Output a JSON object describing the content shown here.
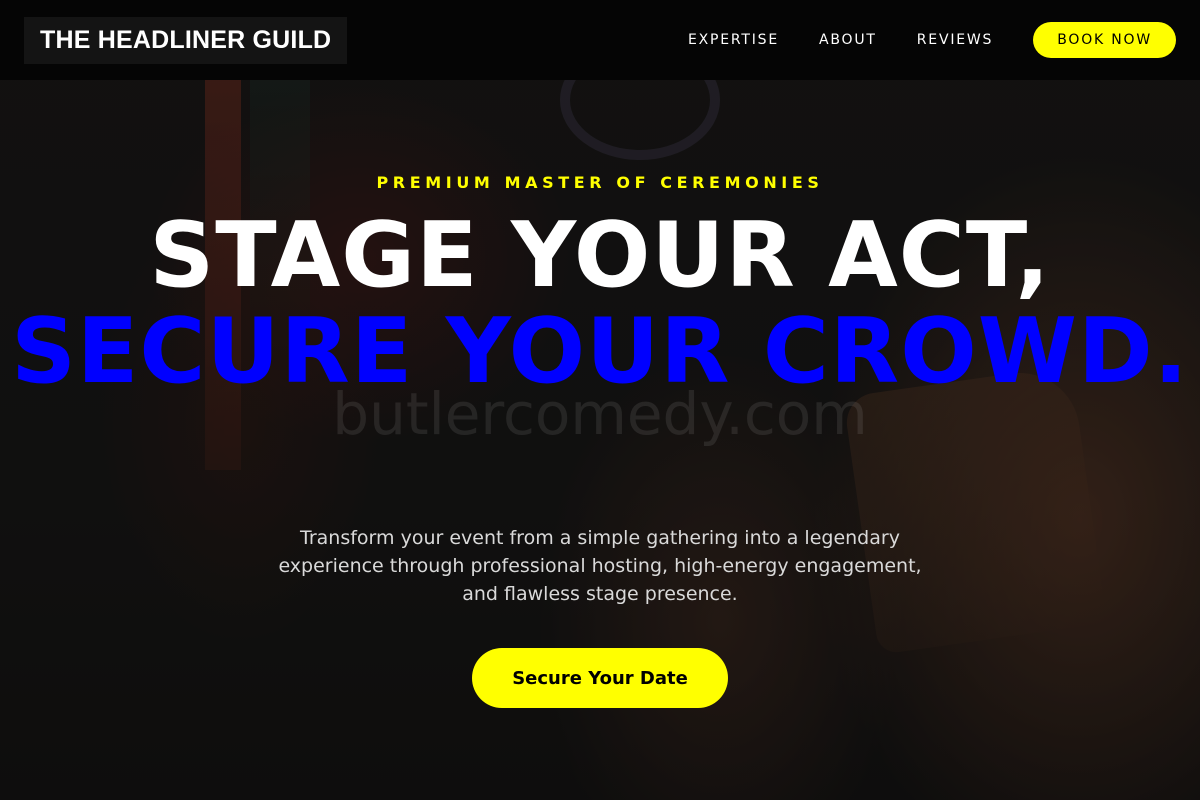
{
  "header": {
    "logo": "THE HEADLINER GUILD",
    "nav": [
      "EXPERTISE",
      "ABOUT",
      "REVIEWS"
    ],
    "book_label": "BOOK NOW"
  },
  "hero": {
    "eyebrow": "PREMIUM MASTER OF CEREMONIES",
    "headline_line1": "STAGE YOUR ACT,",
    "headline_line2": "SECURE YOUR CROWD.",
    "watermark": "butlercomedy.com",
    "subtitle": "Transform your event from a simple gathering into a legendary experience through professional hosting, high-energy engagement, and flawless stage presence.",
    "cta_label": "Secure Your Date"
  },
  "colors": {
    "accent_yellow": "#ffff00",
    "accent_blue": "#0000ff",
    "header_bg": "#050505"
  }
}
